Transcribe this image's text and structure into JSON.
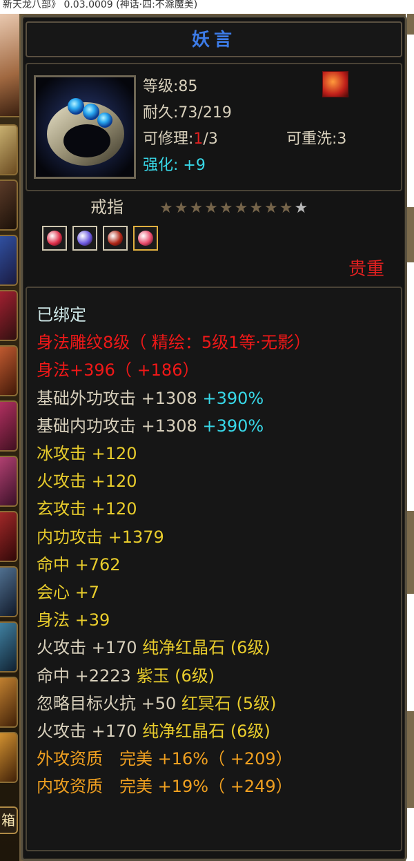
{
  "window": {
    "title_fragment": "新天龙八部》 0.03.0009 (神话·四:不滁魔美)"
  },
  "sidebar": {
    "menu_label": "箱"
  },
  "item": {
    "name": "妖言",
    "icon": "ring-with-blue-gems-icon",
    "badge_icon": "flame-badge-icon",
    "level": "等级:85",
    "durability": "耐久:73/219",
    "repair_prefix": "可修理:",
    "repair_used": "1",
    "repair_total": "/3",
    "reroll": "可重洗:3",
    "enhance_label": "强化:",
    "enhance_value": " +9",
    "type": "戒指",
    "stars_filled": "★★★★★★★★★",
    "stars_empty": "★",
    "star_rating": {
      "filled": 9,
      "total": 10
    },
    "gems": [
      {
        "icon": "red-gem-icon",
        "color": "#e0304a"
      },
      {
        "icon": "purple-gem-icon",
        "color": "#6a58e0"
      },
      {
        "icon": "dark-red-gem-icon",
        "color": "#b02818"
      },
      {
        "icon": "pink-gem-icon",
        "color": "#e84a6a"
      }
    ],
    "rarity": "贵重"
  },
  "attributes": [
    {
      "text": "已绑定",
      "color": "#cde6e6"
    },
    {
      "text": "身法雕纹8级（ 精绘：5级1等·无影）",
      "color": "#f01818"
    },
    {
      "text": "身法+396（ +186）",
      "color": "#f01818"
    },
    {
      "text": "基础外功攻击 +1308 ",
      "color": "#d8d0bc",
      "extra": "+390%"
    },
    {
      "text": "基础内功攻击 +1308 ",
      "color": "#d8d0bc",
      "extra": "+390%"
    },
    {
      "text": "冰攻击 +120",
      "color": "#e8cc2c"
    },
    {
      "text": "火攻击 +120",
      "color": "#e8cc2c"
    },
    {
      "text": "玄攻击 +120",
      "color": "#e8cc2c"
    },
    {
      "text": "内功攻击 +1379",
      "color": "#e8cc2c"
    },
    {
      "text": "命中 +762",
      "color": "#e8cc2c"
    },
    {
      "text": "会心 +7",
      "color": "#e8cc2c"
    },
    {
      "text": "身法 +39",
      "color": "#e8cc2c"
    },
    {
      "text": "火攻击 +170 ",
      "color": "#d8d0bc",
      "extra": "纯净红晶石 (6级)"
    },
    {
      "text": "命中 +2223 ",
      "color": "#d8d0bc",
      "extra": "紫玉 (6级)"
    },
    {
      "text": "忽略目标火抗 +50 ",
      "color": "#d8d0bc",
      "extra": "红冥石 (5级)"
    },
    {
      "text": "火攻击 +170 ",
      "color": "#d8d0bc",
      "extra": "纯净红晶石 (6级)"
    },
    {
      "text": "外攻资质　完美 +16%（ +209）",
      "color": "#f0a020"
    },
    {
      "text": "内攻资质　完美 +19%（ +249）",
      "color": "#f0a020"
    }
  ],
  "colors": {
    "title": "#3d7ce8",
    "rarity": "#e02020",
    "enhance": "#38d8e8",
    "gem_text": "#e8cc2c",
    "cyan": "#38d8e8"
  }
}
